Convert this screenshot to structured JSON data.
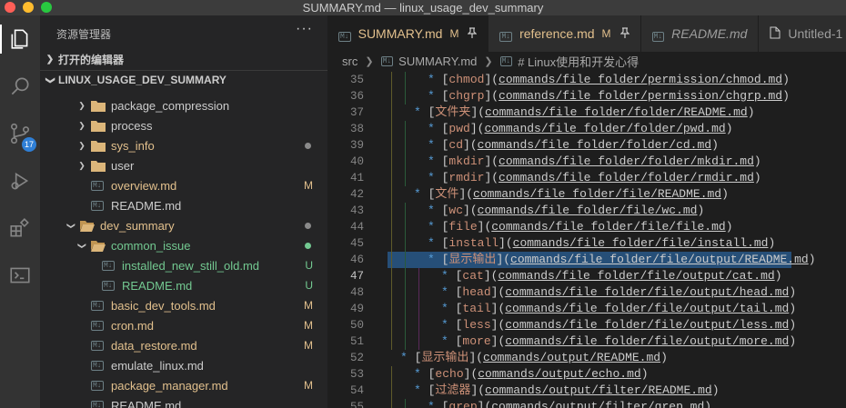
{
  "window": {
    "title": "SUMMARY.md — linux_usage_dev_summary"
  },
  "activity_bar": {
    "scm_badge": "17"
  },
  "sidebar": {
    "title": "资源管理器",
    "more": "···",
    "open_editors_label": "打开的编辑器",
    "workspace_label": "LINUX_USAGE_DEV_SUMMARY",
    "tree": [
      {
        "label": "package_compression",
        "type": "folder",
        "expanded": false,
        "deco": ""
      },
      {
        "label": "process",
        "type": "folder",
        "expanded": false,
        "deco": ""
      },
      {
        "label": "sys_info",
        "type": "folder",
        "expanded": false,
        "deco": "dot-grey",
        "color": "mod"
      },
      {
        "label": "user",
        "type": "folder",
        "expanded": false,
        "deco": ""
      },
      {
        "label": "overview.md",
        "type": "md",
        "deco": "M",
        "color": "mod"
      },
      {
        "label": "README.md",
        "type": "md",
        "deco": "",
        "color": "norm"
      },
      {
        "label": "dev_summary",
        "type": "folder",
        "expanded": true,
        "deco": "dot-grey",
        "color": "mod"
      },
      {
        "label": "common_issue",
        "type": "folder",
        "expanded": true,
        "deco": "dot-green",
        "color": "unt"
      },
      {
        "label": "installed_new_still_old.md",
        "type": "md",
        "deco": "U",
        "color": "unt"
      },
      {
        "label": "README.md",
        "type": "md",
        "deco": "U",
        "color": "unt"
      },
      {
        "label": "basic_dev_tools.md",
        "type": "md",
        "deco": "M",
        "color": "mod"
      },
      {
        "label": "cron.md",
        "type": "md",
        "deco": "M",
        "color": "mod"
      },
      {
        "label": "data_restore.md",
        "type": "md",
        "deco": "M",
        "color": "mod"
      },
      {
        "label": "emulate_linux.md",
        "type": "md",
        "deco": "",
        "color": "norm"
      },
      {
        "label": "package_manager.md",
        "type": "md",
        "deco": "M",
        "color": "mod"
      },
      {
        "label": "README.md",
        "type": "md",
        "deco": "",
        "color": "norm"
      }
    ]
  },
  "tabs": [
    {
      "icon": "M↓",
      "label": "SUMMARY.md",
      "mark": "M",
      "pin": true,
      "active": true,
      "color": "mod"
    },
    {
      "icon": "M↓",
      "label": "reference.md",
      "mark": "M",
      "pin": true,
      "active": false,
      "color": "mod"
    },
    {
      "icon": "M↓",
      "label": "README.md",
      "mark": "",
      "pin": false,
      "active": false,
      "color": "italic"
    },
    {
      "icon": "file",
      "label": "Untitled-1",
      "mark": "",
      "pin": false,
      "active": false,
      "color": "norm"
    }
  ],
  "breadcrumb": {
    "folder": "src",
    "icon": "M↓",
    "file": "SUMMARY.md",
    "symbol_icon": "M↓",
    "symbol": "# Linux使用和开发心得"
  },
  "editor": {
    "current_line": 47,
    "highlight_line": 46,
    "lines": [
      {
        "n": 35,
        "indent": 2,
        "text": "chmod",
        "url": "commands/file_folder/permission/chmod.md"
      },
      {
        "n": 36,
        "indent": 2,
        "text": "chgrp",
        "url": "commands/file_folder/permission/chgrp.md"
      },
      {
        "n": 37,
        "indent": 1,
        "text": "文件夹",
        "url": "commands/file_folder/folder/README.md"
      },
      {
        "n": 38,
        "indent": 2,
        "text": "pwd",
        "url": "commands/file_folder/folder/pwd.md"
      },
      {
        "n": 39,
        "indent": 2,
        "text": "cd",
        "url": "commands/file_folder/folder/cd.md"
      },
      {
        "n": 40,
        "indent": 2,
        "text": "mkdir",
        "url": "commands/file_folder/folder/mkdir.md"
      },
      {
        "n": 41,
        "indent": 2,
        "text": "rmdir",
        "url": "commands/file_folder/folder/rmdir.md"
      },
      {
        "n": 42,
        "indent": 1,
        "text": "文件",
        "url": "commands/file_folder/file/README.md"
      },
      {
        "n": 43,
        "indent": 2,
        "text": "wc",
        "url": "commands/file_folder/file/wc.md"
      },
      {
        "n": 44,
        "indent": 2,
        "text": "file",
        "url": "commands/file_folder/file/file.md"
      },
      {
        "n": 45,
        "indent": 2,
        "text": "install",
        "url": "commands/file_folder/file/install.md"
      },
      {
        "n": 46,
        "indent": 2,
        "text": "显示输出",
        "url": "commands/file_folder/file/output/README.md"
      },
      {
        "n": 47,
        "indent": 3,
        "text": "cat",
        "url": "commands/file_folder/file/output/cat.md"
      },
      {
        "n": 48,
        "indent": 3,
        "text": "head",
        "url": "commands/file_folder/file/output/head.md"
      },
      {
        "n": 49,
        "indent": 3,
        "text": "tail",
        "url": "commands/file_folder/file/output/tail.md"
      },
      {
        "n": 50,
        "indent": 3,
        "text": "less",
        "url": "commands/file_folder/file/output/less.md"
      },
      {
        "n": 51,
        "indent": 3,
        "text": "more",
        "url": "commands/file_folder/file/output/more.md"
      },
      {
        "n": 52,
        "indent": 0,
        "text": "显示输出",
        "url": "commands/output/README.md"
      },
      {
        "n": 53,
        "indent": 1,
        "text": "echo",
        "url": "commands/output/echo.md"
      },
      {
        "n": 54,
        "indent": 1,
        "text": "过滤器",
        "url": "commands/output/filter/README.md"
      },
      {
        "n": 55,
        "indent": 2,
        "text": "grep",
        "url": "commands/output/filter/grep.md"
      }
    ]
  },
  "colors": {
    "modified": "#e2c08d",
    "untracked": "#73c991",
    "accent": "#2f7fd6",
    "selection": "#264f78"
  }
}
